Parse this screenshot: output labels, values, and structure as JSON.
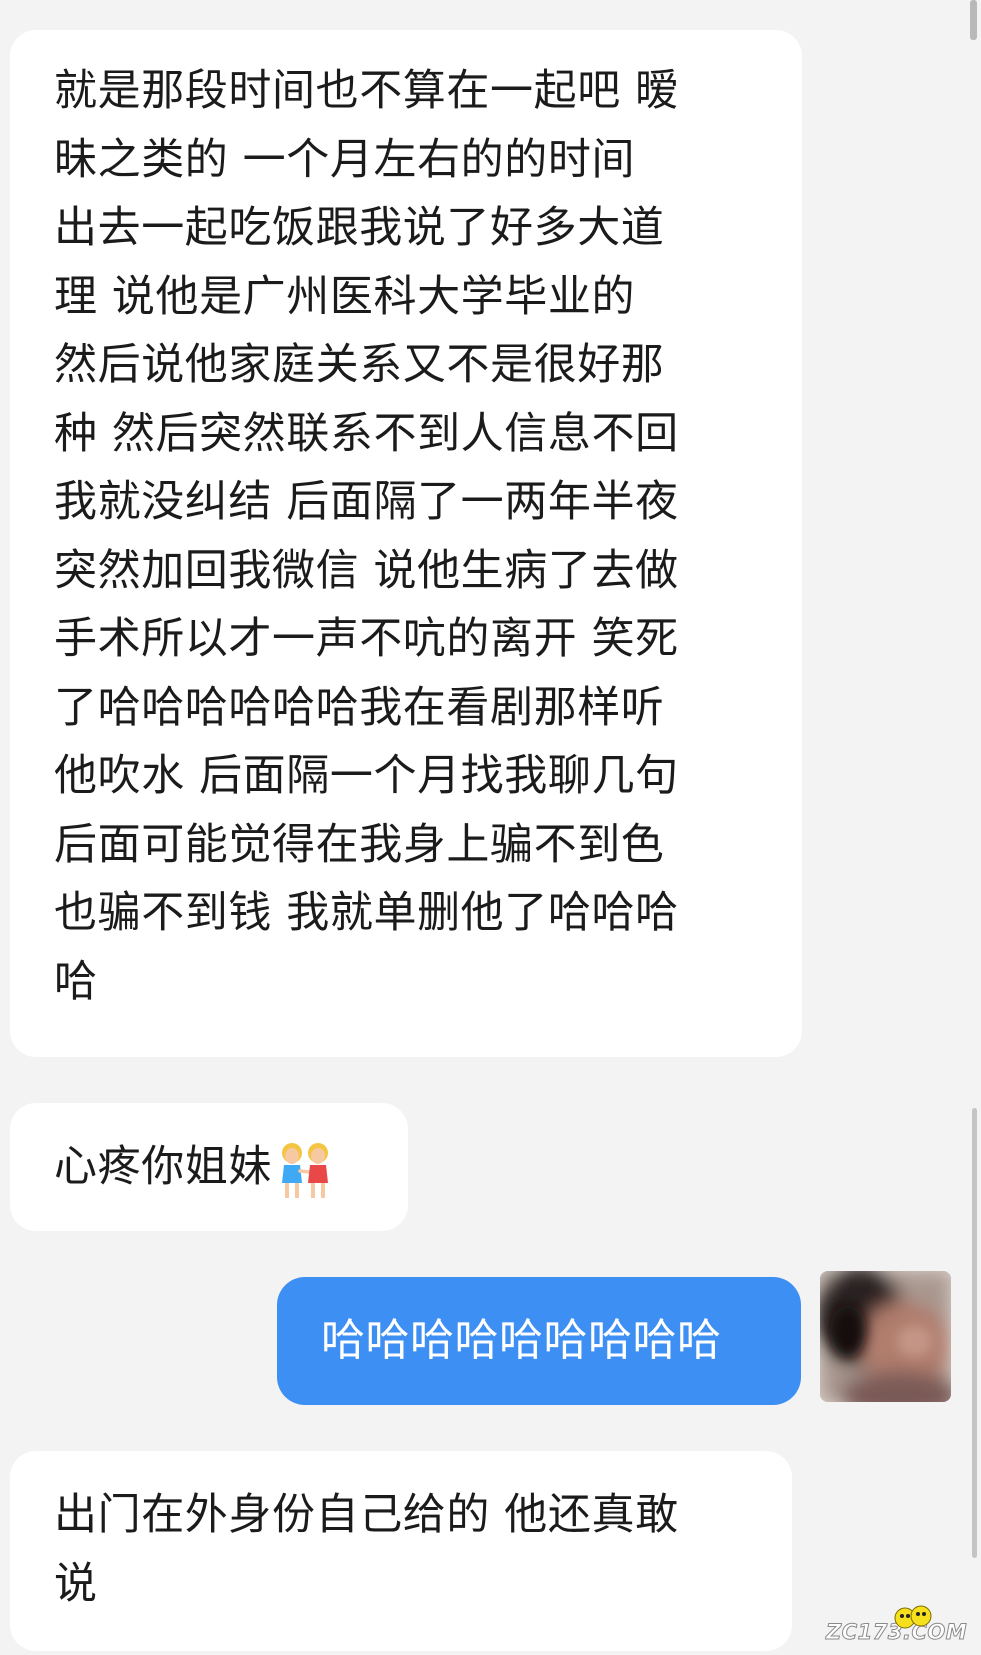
{
  "messages": [
    {
      "side": "incoming",
      "text": "就是那段时间也不算在一起吧 暧\n昧之类的 一个月左右的的时间\n出去一起吃饭跟我说了好多大道\n理 说他是广州医科大学毕业的\n然后说他家庭关系又不是很好那\n种 然后突然联系不到人信息不回\n我就没纠结 后面隔了一两年半夜\n突然加回我微信 说他生病了去做\n手术所以才一声不吭的离开 笑死\n了哈哈哈哈哈哈我在看剧那样听\n他吹水 后面隔一个月找我聊几句\n后面可能觉得在我身上骗不到色\n也骗不到钱 我就单删他了哈哈哈\n哈"
    },
    {
      "side": "incoming",
      "text": "心疼你姐妹",
      "emoji": "two-women-holding-hands-icon"
    },
    {
      "side": "outgoing",
      "text": "哈哈哈哈哈哈哈哈哈"
    },
    {
      "side": "incoming",
      "text": "出门在外身份自己给的 他还真敢\n说"
    }
  ],
  "watermark": {
    "text": "ZC173.COM"
  },
  "colors": {
    "background": "#f3f3f3",
    "incoming_bubble": "#ffffff",
    "outgoing_bubble": "#3e8ff3",
    "outgoing_text": "#ffffff",
    "incoming_text": "#1b1b1b"
  }
}
